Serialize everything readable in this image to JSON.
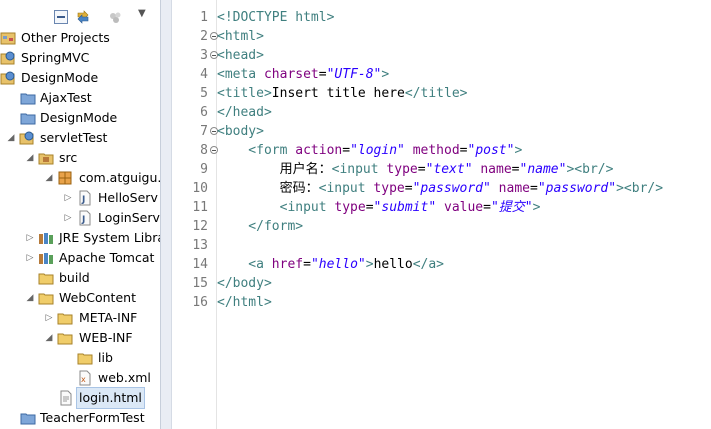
{
  "explorer": {
    "items": [
      {
        "label": "Other Projects",
        "icon": "projects-group-icon"
      },
      {
        "label": "SpringMVC",
        "icon": "web-project-icon"
      },
      {
        "label": "DesignMode",
        "icon": "web-project-icon"
      },
      {
        "label": "AjaxTest",
        "icon": "closed-project-icon"
      },
      {
        "label": "DesignMode",
        "icon": "closed-project-icon"
      },
      {
        "label": "servletTest",
        "icon": "web-project-icon"
      },
      {
        "label": "src",
        "icon": "source-folder-icon"
      },
      {
        "label": "com.atguigu.",
        "icon": "package-icon"
      },
      {
        "label": "HelloServ",
        "icon": "java-file-icon"
      },
      {
        "label": "LoginServ",
        "icon": "java-file-icon"
      },
      {
        "label": "JRE System Libra",
        "icon": "library-icon"
      },
      {
        "label": "Apache Tomcat",
        "icon": "library-icon"
      },
      {
        "label": "build",
        "icon": "folder-icon"
      },
      {
        "label": "WebContent",
        "icon": "folder-icon"
      },
      {
        "label": "META-INF",
        "icon": "folder-icon"
      },
      {
        "label": "WEB-INF",
        "icon": "folder-icon"
      },
      {
        "label": "lib",
        "icon": "folder-icon"
      },
      {
        "label": "web.xml",
        "icon": "xml-file-icon"
      },
      {
        "label": "login.html",
        "icon": "html-file-icon"
      },
      {
        "label": "TeacherFormTest",
        "icon": "closed-project-icon"
      }
    ]
  },
  "editor": {
    "line_numbers": [
      "1",
      "2",
      "3",
      "4",
      "5",
      "6",
      "7",
      "8",
      "9",
      "10",
      "11",
      "12",
      "13",
      "14",
      "15",
      "16"
    ],
    "lines": [
      [
        {
          "t": "<!DOCTYPE html>",
          "c": "doctype"
        }
      ],
      [
        {
          "t": "<html>",
          "c": "tag"
        }
      ],
      [
        {
          "t": "<head>",
          "c": "tag"
        }
      ],
      [
        {
          "t": "<meta ",
          "c": "tag"
        },
        {
          "t": "charset",
          "c": "attr"
        },
        {
          "t": "=",
          "c": "txt"
        },
        {
          "t": "\"UTF-8\"",
          "c": "val"
        },
        {
          "t": ">",
          "c": "tag"
        }
      ],
      [
        {
          "t": "<title>",
          "c": "tag"
        },
        {
          "t": "Insert title here",
          "c": "txt"
        },
        {
          "t": "</title>",
          "c": "tag"
        }
      ],
      [
        {
          "t": "</head>",
          "c": "tag"
        }
      ],
      [
        {
          "t": "<body>",
          "c": "tag"
        }
      ],
      [
        {
          "t": "    <form ",
          "c": "tag"
        },
        {
          "t": "action",
          "c": "attr"
        },
        {
          "t": "=",
          "c": "txt"
        },
        {
          "t": "\"login\"",
          "c": "val"
        },
        {
          "t": " ",
          "c": "txt"
        },
        {
          "t": "method",
          "c": "attr"
        },
        {
          "t": "=",
          "c": "txt"
        },
        {
          "t": "\"post\"",
          "c": "val"
        },
        {
          "t": ">",
          "c": "tag"
        }
      ],
      [
        {
          "t": "        用户名：",
          "c": "txt"
        },
        {
          "t": "<input ",
          "c": "tag"
        },
        {
          "t": "type",
          "c": "attr"
        },
        {
          "t": "=",
          "c": "txt"
        },
        {
          "t": "\"text\"",
          "c": "val"
        },
        {
          "t": " ",
          "c": "txt"
        },
        {
          "t": "name",
          "c": "attr"
        },
        {
          "t": "=",
          "c": "txt"
        },
        {
          "t": "\"name\"",
          "c": "val"
        },
        {
          "t": "><br/>",
          "c": "tag"
        }
      ],
      [
        {
          "t": "        密码：",
          "c": "txt"
        },
        {
          "t": "<input ",
          "c": "tag"
        },
        {
          "t": "type",
          "c": "attr"
        },
        {
          "t": "=",
          "c": "txt"
        },
        {
          "t": "\"password\"",
          "c": "val"
        },
        {
          "t": " ",
          "c": "txt"
        },
        {
          "t": "name",
          "c": "attr"
        },
        {
          "t": "=",
          "c": "txt"
        },
        {
          "t": "\"password\"",
          "c": "val"
        },
        {
          "t": "><br/>",
          "c": "tag"
        }
      ],
      [
        {
          "t": "        <input ",
          "c": "tag"
        },
        {
          "t": "type",
          "c": "attr"
        },
        {
          "t": "=",
          "c": "txt"
        },
        {
          "t": "\"submit\"",
          "c": "val"
        },
        {
          "t": " ",
          "c": "txt"
        },
        {
          "t": "value",
          "c": "attr"
        },
        {
          "t": "=",
          "c": "txt"
        },
        {
          "t": "\"提交\"",
          "c": "val"
        },
        {
          "t": ">",
          "c": "tag"
        }
      ],
      [
        {
          "t": "    </form>",
          "c": "tag"
        }
      ],
      [
        {
          "t": "",
          "c": "txt"
        }
      ],
      [
        {
          "t": "    <a ",
          "c": "tag"
        },
        {
          "t": "href",
          "c": "attr"
        },
        {
          "t": "=",
          "c": "txt"
        },
        {
          "t": "\"hello\"",
          "c": "val"
        },
        {
          "t": ">",
          "c": "tag"
        },
        {
          "t": "hello",
          "c": "txt"
        },
        {
          "t": "</a>",
          "c": "tag"
        }
      ],
      [
        {
          "t": "</body>",
          "c": "tag"
        }
      ],
      [
        {
          "t": "</html>",
          "c": "tag"
        }
      ]
    ],
    "foldable_lines": [
      2,
      3,
      7,
      8
    ]
  },
  "colors": {
    "tag": "#3f7f7f",
    "attr": "#7f007f",
    "value": "#2a00ff",
    "selection": "#dbe8f6"
  }
}
